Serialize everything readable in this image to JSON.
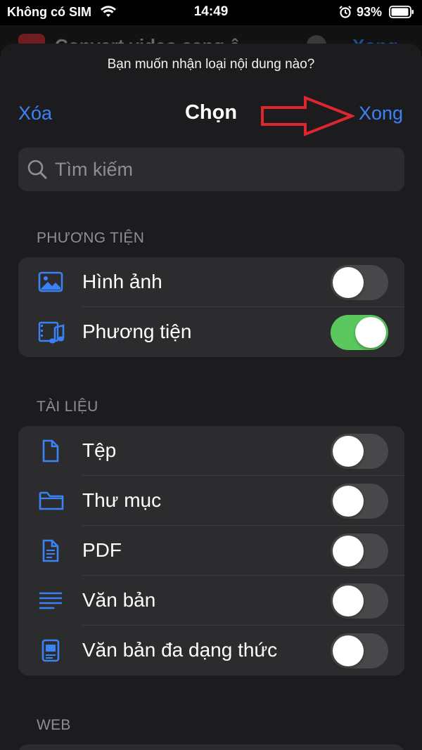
{
  "status_bar": {
    "carrier": "Không có SIM",
    "time": "14:49",
    "battery": "93%"
  },
  "background_app": {
    "title": "Convert video sang ê",
    "done_label": "Xong"
  },
  "sheet": {
    "prompt": "Bạn muốn nhận loại nội dung nào?",
    "nav": {
      "clear_label": "Xóa",
      "title": "Chọn",
      "done_label": "Xong"
    },
    "search": {
      "placeholder": "Tìm kiếm"
    },
    "sections": [
      {
        "header": "PHƯƠNG TIỆN",
        "items": [
          {
            "label": "Hình ảnh",
            "icon": "photo-icon",
            "enabled": false
          },
          {
            "label": "Phương tiện",
            "icon": "media-icon",
            "enabled": true
          }
        ]
      },
      {
        "header": "TÀI LIỆU",
        "items": [
          {
            "label": "Tệp",
            "icon": "file-icon",
            "enabled": false
          },
          {
            "label": "Thư mục",
            "icon": "folder-icon",
            "enabled": false
          },
          {
            "label": "PDF",
            "icon": "pdf-icon",
            "enabled": false
          },
          {
            "label": "Văn bản",
            "icon": "text-icon",
            "enabled": false
          },
          {
            "label": "Văn bản đa dạng thức",
            "icon": "rich-text-icon",
            "enabled": false
          }
        ]
      },
      {
        "header": "WEB",
        "items": []
      }
    ]
  },
  "colors": {
    "accent": "#3b82f6",
    "toggle_on": "#5ac85f",
    "annotation_arrow": "#e0262d"
  }
}
